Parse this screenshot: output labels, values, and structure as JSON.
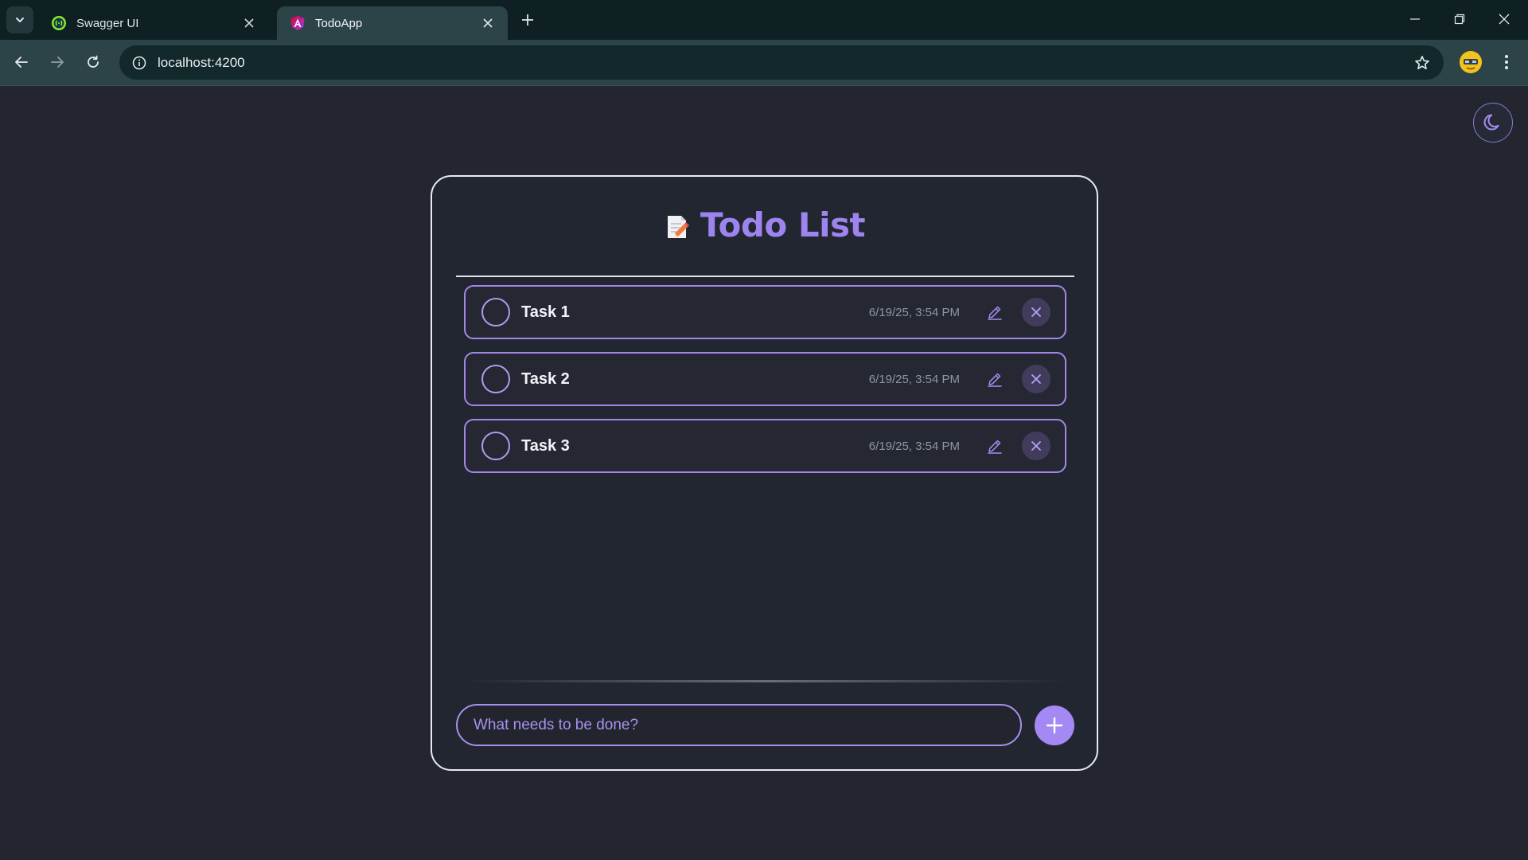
{
  "browser": {
    "tabs": [
      {
        "title": "Swagger UI",
        "icon": "swagger-favicon",
        "active": false
      },
      {
        "title": "TodoApp",
        "icon": "angular-favicon",
        "active": true
      }
    ],
    "address": "localhost:4200"
  },
  "app": {
    "title": "Todo List",
    "title_icon": "memo-icon",
    "theme_toggle_icon": "moon-icon",
    "tasks": [
      {
        "label": "Task 1",
        "timestamp": "6/19/25, 3:54 PM",
        "completed": false
      },
      {
        "label": "Task 2",
        "timestamp": "6/19/25, 3:54 PM",
        "completed": false
      },
      {
        "label": "Task 3",
        "timestamp": "6/19/25, 3:54 PM",
        "completed": false
      }
    ],
    "input_placeholder": "What needs to be done?",
    "add_icon": "plus-icon"
  },
  "colors": {
    "accent": "#a489f4",
    "background": "#23262f",
    "card_border": "#e9e9f2",
    "title": "#9d84ee"
  }
}
